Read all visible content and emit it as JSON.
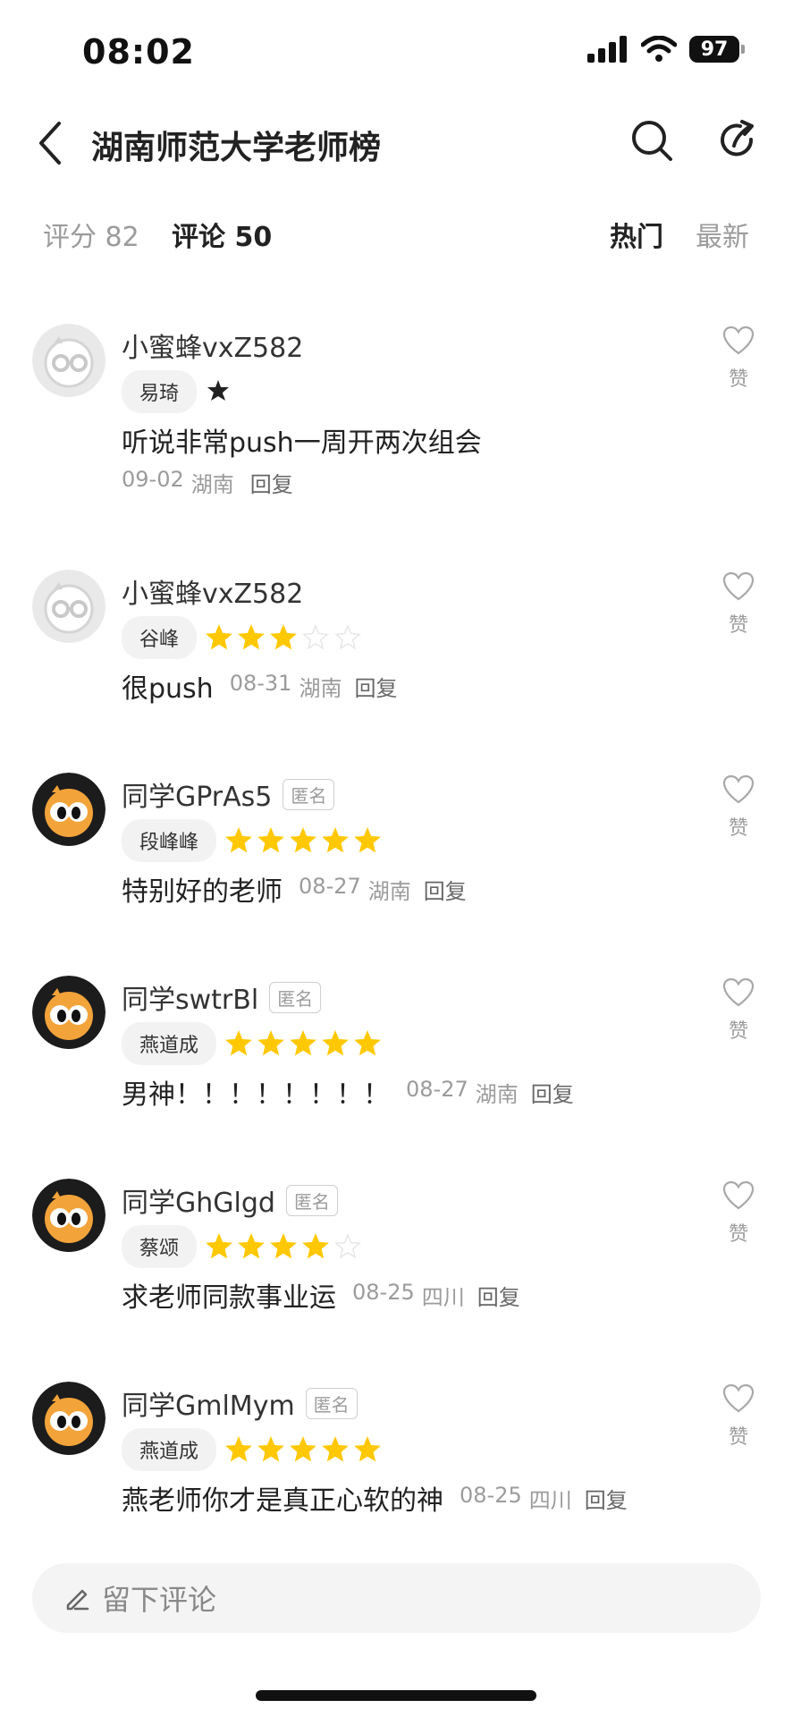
{
  "status_bar": {
    "time": "08:02",
    "battery": "97"
  },
  "header": {
    "title": "湖南师范大学老师榜"
  },
  "tabs": {
    "score": "评分 82",
    "comment": "评论 50",
    "sort_hot": "热门",
    "sort_new": "最新"
  },
  "like_label": "赞",
  "reply_label": "回复",
  "comments": [
    {
      "user": "小蜜蜂vxZ582",
      "anonymous": "",
      "teacher": "易琦",
      "rating": null,
      "content": "听说非常push一周开两次组会",
      "date": "09-02",
      "region": "湖南"
    },
    {
      "user": "小蜜蜂vxZ582",
      "anonymous": "",
      "teacher": "谷峰",
      "rating": 3,
      "content": "很push",
      "date": "08-31",
      "region": "湖南"
    },
    {
      "user": "同学GPrAs5",
      "anonymous": "匿名",
      "teacher": "段峰峰",
      "rating": 5,
      "content": "特别好的老师",
      "date": "08-27",
      "region": "湖南"
    },
    {
      "user": "同学swtrBl",
      "anonymous": "匿名",
      "teacher": "燕道成",
      "rating": 5,
      "content": "男神！！！！！！！！",
      "date": "08-27",
      "region": "湖南"
    },
    {
      "user": "同学GhGlgd",
      "anonymous": "匿名",
      "teacher": "蔡颂",
      "rating": 4,
      "content": "求老师同款事业运",
      "date": "08-25",
      "region": "四川"
    },
    {
      "user": "同学GmlMym",
      "anonymous": "匿名",
      "teacher": "燕道成",
      "rating": 5,
      "content": "燕老师你才是真正心软的神",
      "date": "08-25",
      "region": "四川"
    }
  ],
  "input": {
    "placeholder": "留下评论"
  },
  "colors": {
    "star": "#FFC800",
    "star_empty": "#E6E6E6",
    "muted": "#9B9B9B"
  }
}
